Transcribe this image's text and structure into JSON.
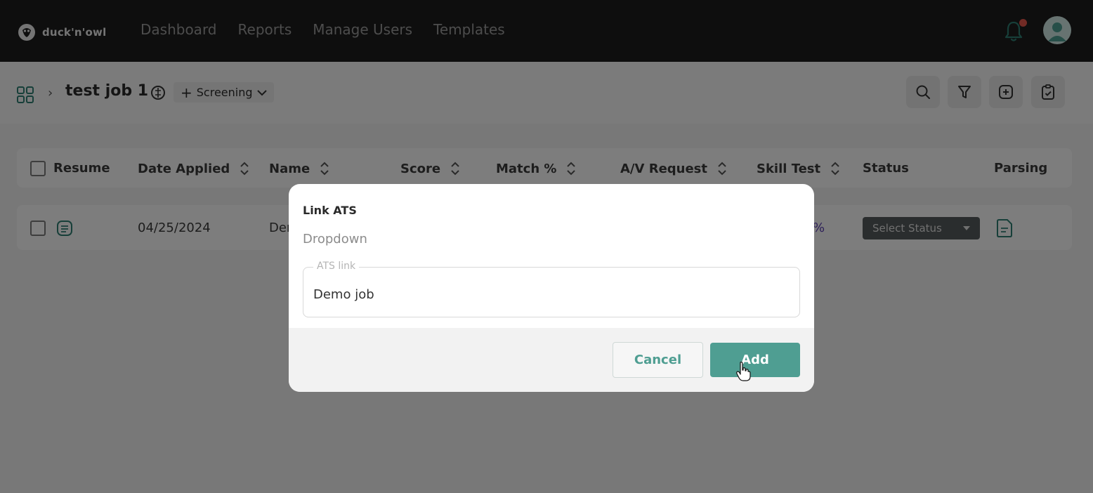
{
  "brand": {
    "name": "duck'n'owl"
  },
  "nav": {
    "items": [
      "Dashboard",
      "Reports",
      "Manage Users",
      "Templates"
    ]
  },
  "header": {
    "job_title": "test job 1",
    "stage_label": "Screening",
    "breadcrumb_separator": "›"
  },
  "table": {
    "columns": [
      "Resume",
      "Date Applied",
      "Name",
      "Score",
      "Match %",
      "A/V Request",
      "Skill Test",
      "Status",
      "Parsing"
    ],
    "row": {
      "date_applied": "04/25/2024",
      "name_partial": "Der",
      "match_partial": "%",
      "status_placeholder": "Select Status"
    }
  },
  "modal": {
    "title": "Link ATS",
    "subtitle": "Dropdown",
    "field_label": "ATS link",
    "field_value": "Demo job",
    "cancel_label": "Cancel",
    "add_label": "Add"
  },
  "colors": {
    "accent": "#4f9e92",
    "topbar": "#1c1c1c",
    "notification_dot": "#e4574b"
  }
}
